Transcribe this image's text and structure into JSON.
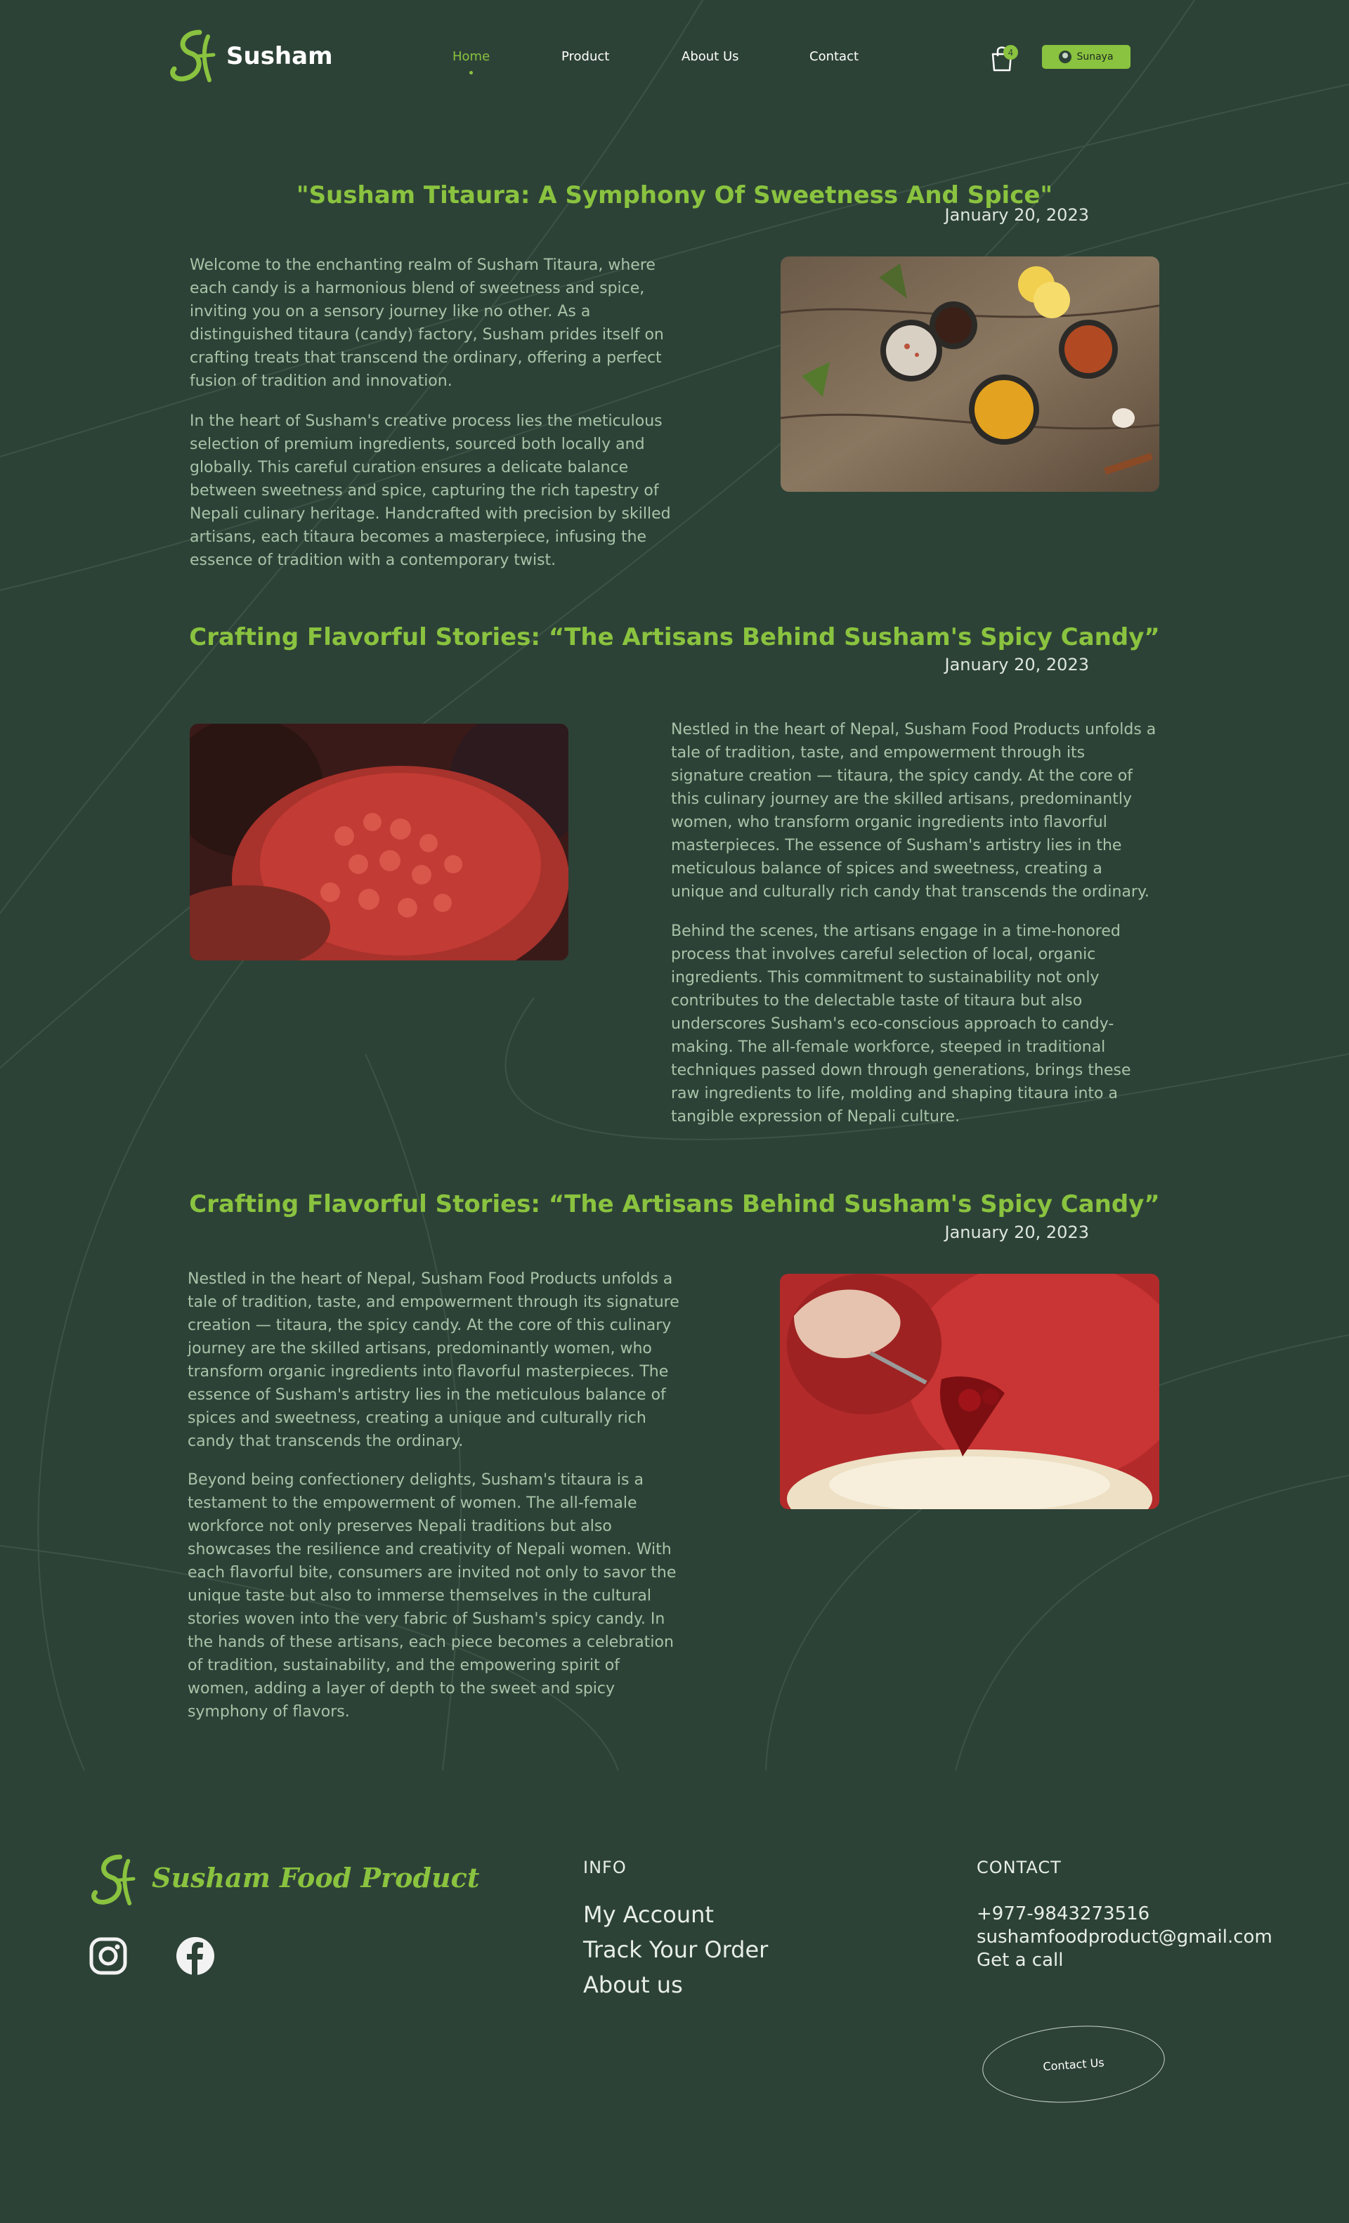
{
  "header": {
    "brand": "Susham",
    "nav": [
      "Home",
      "Product",
      "About Us",
      "Contact"
    ],
    "active_nav": "Home",
    "cart_count": "4",
    "user_name": "Sunaya"
  },
  "articles": [
    {
      "title": "\"Susham Titaura: A Symphony Of Sweetness And Spice\"",
      "date": "January 20, 2023",
      "paragraphs": [
        "Welcome to the enchanting realm of Susham Titaura, where each candy is a harmonious blend of sweetness and spice, inviting you on a sensory journey like no other. As a distinguished titaura (candy) factory, Susham prides itself on crafting treats that transcend the ordinary, offering a perfect fusion of tradition and innovation.",
        "In the heart of Susham's creative process lies the meticulous selection of premium ingredients, sourced both locally and globally. This careful curation ensures a delicate balance between sweetness and spice, capturing the rich tapestry of Nepali culinary heritage. Handcrafted with precision by skilled artisans, each titaura becomes a masterpiece, infusing the essence of tradition with a contemporary twist."
      ]
    },
    {
      "title": "Crafting Flavorful Stories: “The Artisans Behind Susham's Spicy Candy”",
      "date": "January 20, 2023",
      "paragraphs": [
        "Nestled in the heart of Nepal, Susham Food Products unfolds a tale of tradition, taste, and empowerment through its signature creation — titaura, the spicy candy. At the core of this culinary journey are the skilled artisans, predominantly women, who transform organic ingredients into flavorful masterpieces. The essence of Susham's artistry lies in the meticulous balance of spices and sweetness, creating a unique and culturally rich candy that transcends the ordinary.",
        "Behind the scenes, the artisans engage in a time-honored process that involves careful selection of local, organic ingredients. This commitment to sustainability not only contributes to the delectable taste of titaura but also underscores Susham's eco-conscious approach to candy-making. The all-female workforce, steeped in traditional techniques passed down through generations, brings these raw ingredients to life, molding and shaping titaura into a tangible expression of Nepali culture."
      ]
    },
    {
      "title": "Crafting Flavorful Stories: “The Artisans Behind Susham's Spicy Candy”",
      "date": "January 20, 2023",
      "paragraphs": [
        "Nestled in the heart of Nepal, Susham Food Products unfolds a tale of tradition, taste, and empowerment through its signature creation — titaura, the spicy candy. At the core of this culinary journey are the skilled artisans, predominantly women, who transform organic ingredients into flavorful masterpieces. The essence of Susham's artistry lies in the meticulous balance of spices and sweetness, creating a unique and culturally rich candy that transcends the ordinary.",
        " Beyond being confectionery delights, Susham's titaura is a testament to the empowerment of women. The all-female workforce not only preserves Nepali traditions but also showcases the resilience and creativity of Nepali women. With each flavorful bite, consumers are invited not only to savor the unique taste but also to immerse themselves in the cultural stories woven into the very fabric of Susham's spicy candy. In the hands of these artisans, each piece becomes a celebration of tradition, sustainability, and the empowering spirit of women, adding a layer of depth to the sweet and spicy symphony of flavors."
      ]
    }
  ],
  "footer": {
    "brand": "Susham Food Product",
    "info_heading": "INFO",
    "info_links": [
      "My Account",
      "Track Your Order",
      "About us"
    ],
    "contact_heading": "CONTACT",
    "phone": "+977-9843273516",
    "email": "sushamfoodproduct@gmail.com",
    "call": "Get a call",
    "contact_button": "Contact Us"
  },
  "colors": {
    "background": "#2d4237",
    "accent": "#8ac33f",
    "body_text": "#a8c3a8",
    "light_text": "#e7eee7"
  },
  "icons": [
    "cart-icon",
    "user-avatar",
    "instagram-icon",
    "facebook-icon",
    "susham-logo"
  ]
}
